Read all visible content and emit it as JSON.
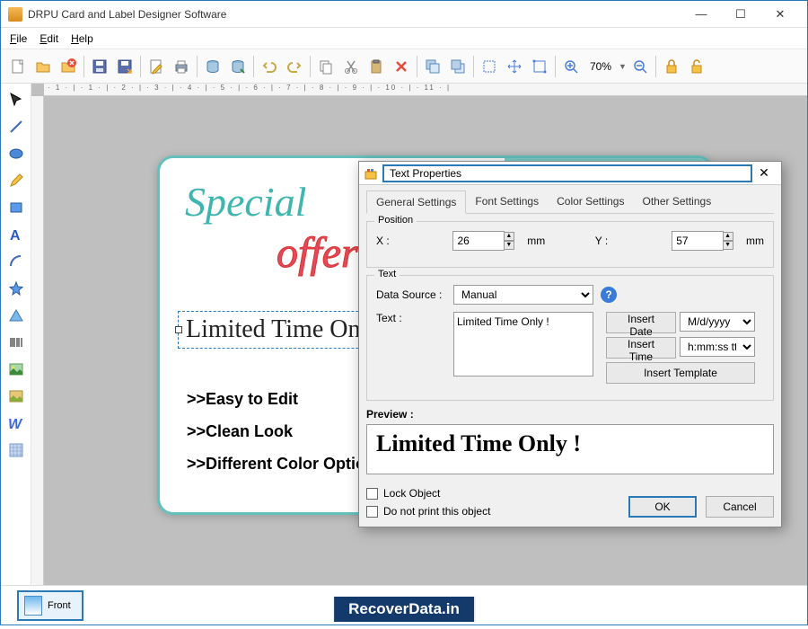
{
  "app": {
    "title": "DRPU Card and Label Designer Software"
  },
  "menu": {
    "file": "File",
    "edit": "Edit",
    "help": "Help"
  },
  "toolbar": {
    "zoom": "70%"
  },
  "canvas": {
    "text_special": "Special",
    "text_offer": "offer",
    "text_selected": "Limited Time Only !",
    "b1": ">>Easy to Edit",
    "b2": ">>Clean Look",
    "b3": ">>Different Color Option"
  },
  "dialog": {
    "title": "Text Properties",
    "tabs": {
      "general": "General Settings",
      "font": "Font Settings",
      "color": "Color Settings",
      "other": "Other Settings"
    },
    "position": {
      "legend": "Position",
      "x_label": "X :",
      "x_val": "26",
      "y_label": "Y :",
      "y_val": "57",
      "unit": "mm"
    },
    "text": {
      "legend": "Text",
      "ds_label": "Data Source :",
      "ds_val": "Manual",
      "text_label": "Text :",
      "text_val": "Limited Time Only !",
      "insert_date": "Insert Date",
      "date_fmt": "M/d/yyyy",
      "insert_time": "Insert Time",
      "time_fmt": "h:mm:ss tt",
      "insert_template": "Insert Template"
    },
    "preview_label": "Preview :",
    "preview_text": "Limited Time Only !",
    "lock": "Lock Object",
    "noprint": "Do not print this object",
    "ok": "OK",
    "cancel": "Cancel"
  },
  "page": {
    "front": "Front"
  },
  "watermark": "RecoverData.in"
}
